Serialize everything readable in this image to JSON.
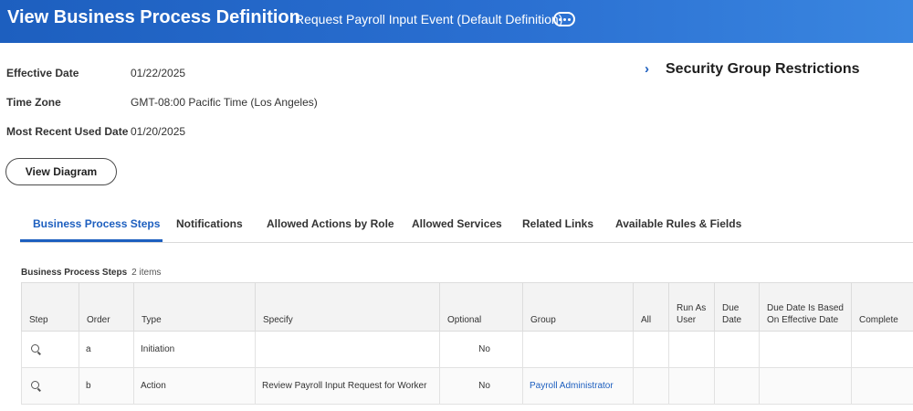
{
  "header": {
    "title": "View Business Process Definition",
    "subtitle": "Request Payroll Input Event (Default Definition)"
  },
  "fields": {
    "effective_date_label": "Effective Date",
    "effective_date_value": "01/22/2025",
    "time_zone_label": "Time Zone",
    "time_zone_value": "GMT-08:00 Pacific Time (Los Angeles)",
    "most_recent_label": "Most Recent Used Date",
    "most_recent_value": "01/20/2025"
  },
  "security": {
    "title": "Security Group Restrictions"
  },
  "buttons": {
    "view_diagram": "View Diagram"
  },
  "tabs": [
    {
      "label": "Business Process Steps",
      "active": true
    },
    {
      "label": "Notifications"
    },
    {
      "label": "Allowed Actions by Role"
    },
    {
      "label": "Allowed Services"
    },
    {
      "label": "Related Links"
    },
    {
      "label": "Available Rules & Fields"
    }
  ],
  "grid": {
    "caption": "Business Process Steps",
    "count": "2 items",
    "columns": [
      "Step",
      "Order",
      "Type",
      "Specify",
      "Optional",
      "Group",
      "All",
      "Run As User",
      "Due Date",
      "Due Date Is Based On Effective Date",
      "Complete"
    ],
    "rows": [
      {
        "order": "a",
        "type": "Initiation",
        "specify": "",
        "optional": "No",
        "group": ""
      },
      {
        "order": "b",
        "type": "Action",
        "specify": "Review Payroll Input Request for Worker",
        "optional": "No",
        "group": "Payroll Administrator"
      }
    ]
  },
  "colors": {
    "header_blue": "#1d5fbf",
    "link_blue": "#1d5fbf"
  }
}
